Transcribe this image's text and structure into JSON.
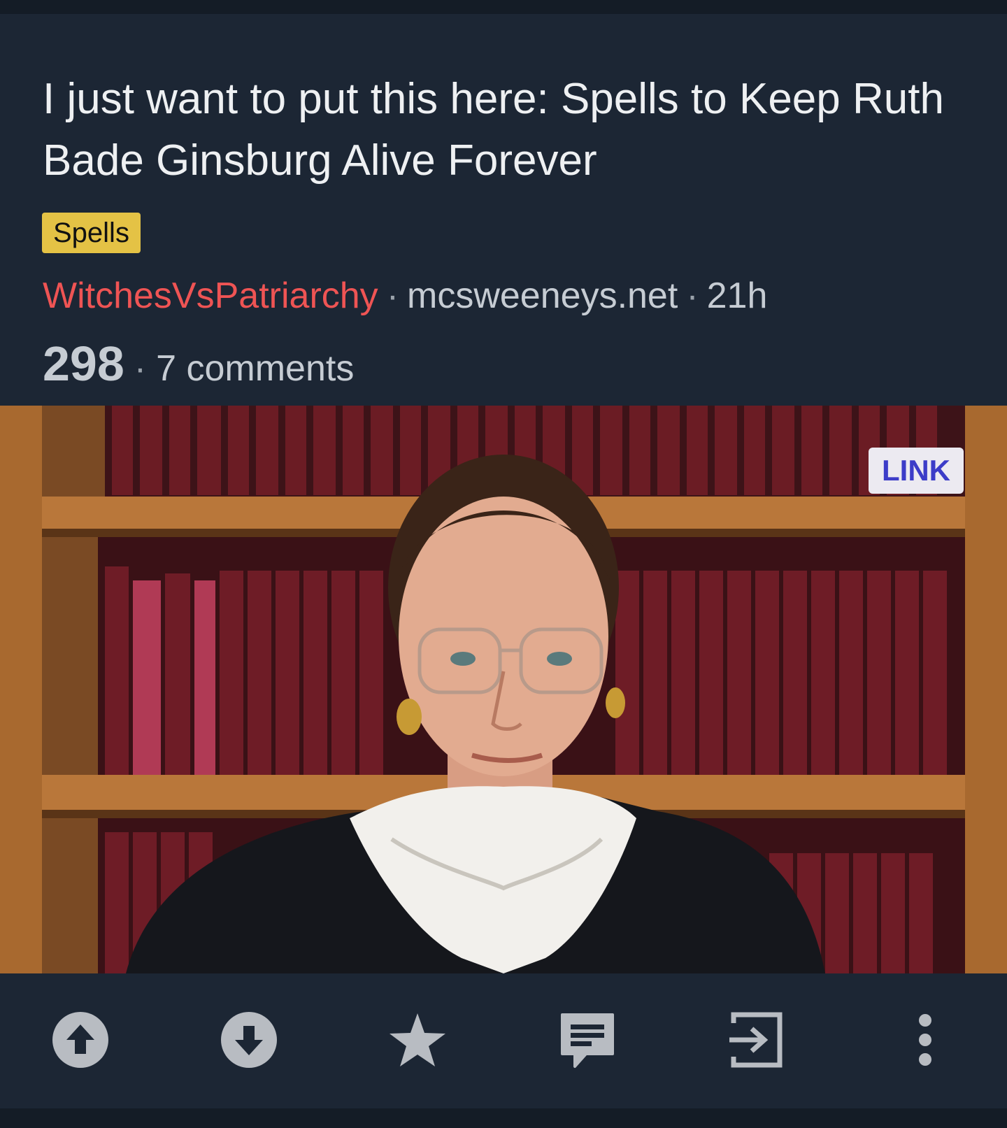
{
  "post": {
    "title": "I just want to put this here: Spells to Keep Ruth Bade Ginsburg Alive Forever",
    "flair": "Spells",
    "subreddit": "WitchesVsPatriarchy",
    "domain": "mcsweeneys.net",
    "age": "21h",
    "separator": "·",
    "score": "298",
    "comments": "7 comments"
  },
  "thumbnail": {
    "badge": "LINK"
  },
  "actions": [
    {
      "name": "upvote",
      "icon": "arrow-up-circle-icon"
    },
    {
      "name": "downvote",
      "icon": "arrow-down-circle-icon"
    },
    {
      "name": "save",
      "icon": "star-icon"
    },
    {
      "name": "comments",
      "icon": "comment-icon"
    },
    {
      "name": "open",
      "icon": "open-link-icon"
    },
    {
      "name": "more",
      "icon": "more-vertical-icon"
    }
  ],
  "colors": {
    "background": "#1c2634",
    "subreddit": "#ef5454",
    "flair": "#e4c245",
    "badge_text": "#3c3cc8",
    "icon": "#b8bcc2"
  }
}
